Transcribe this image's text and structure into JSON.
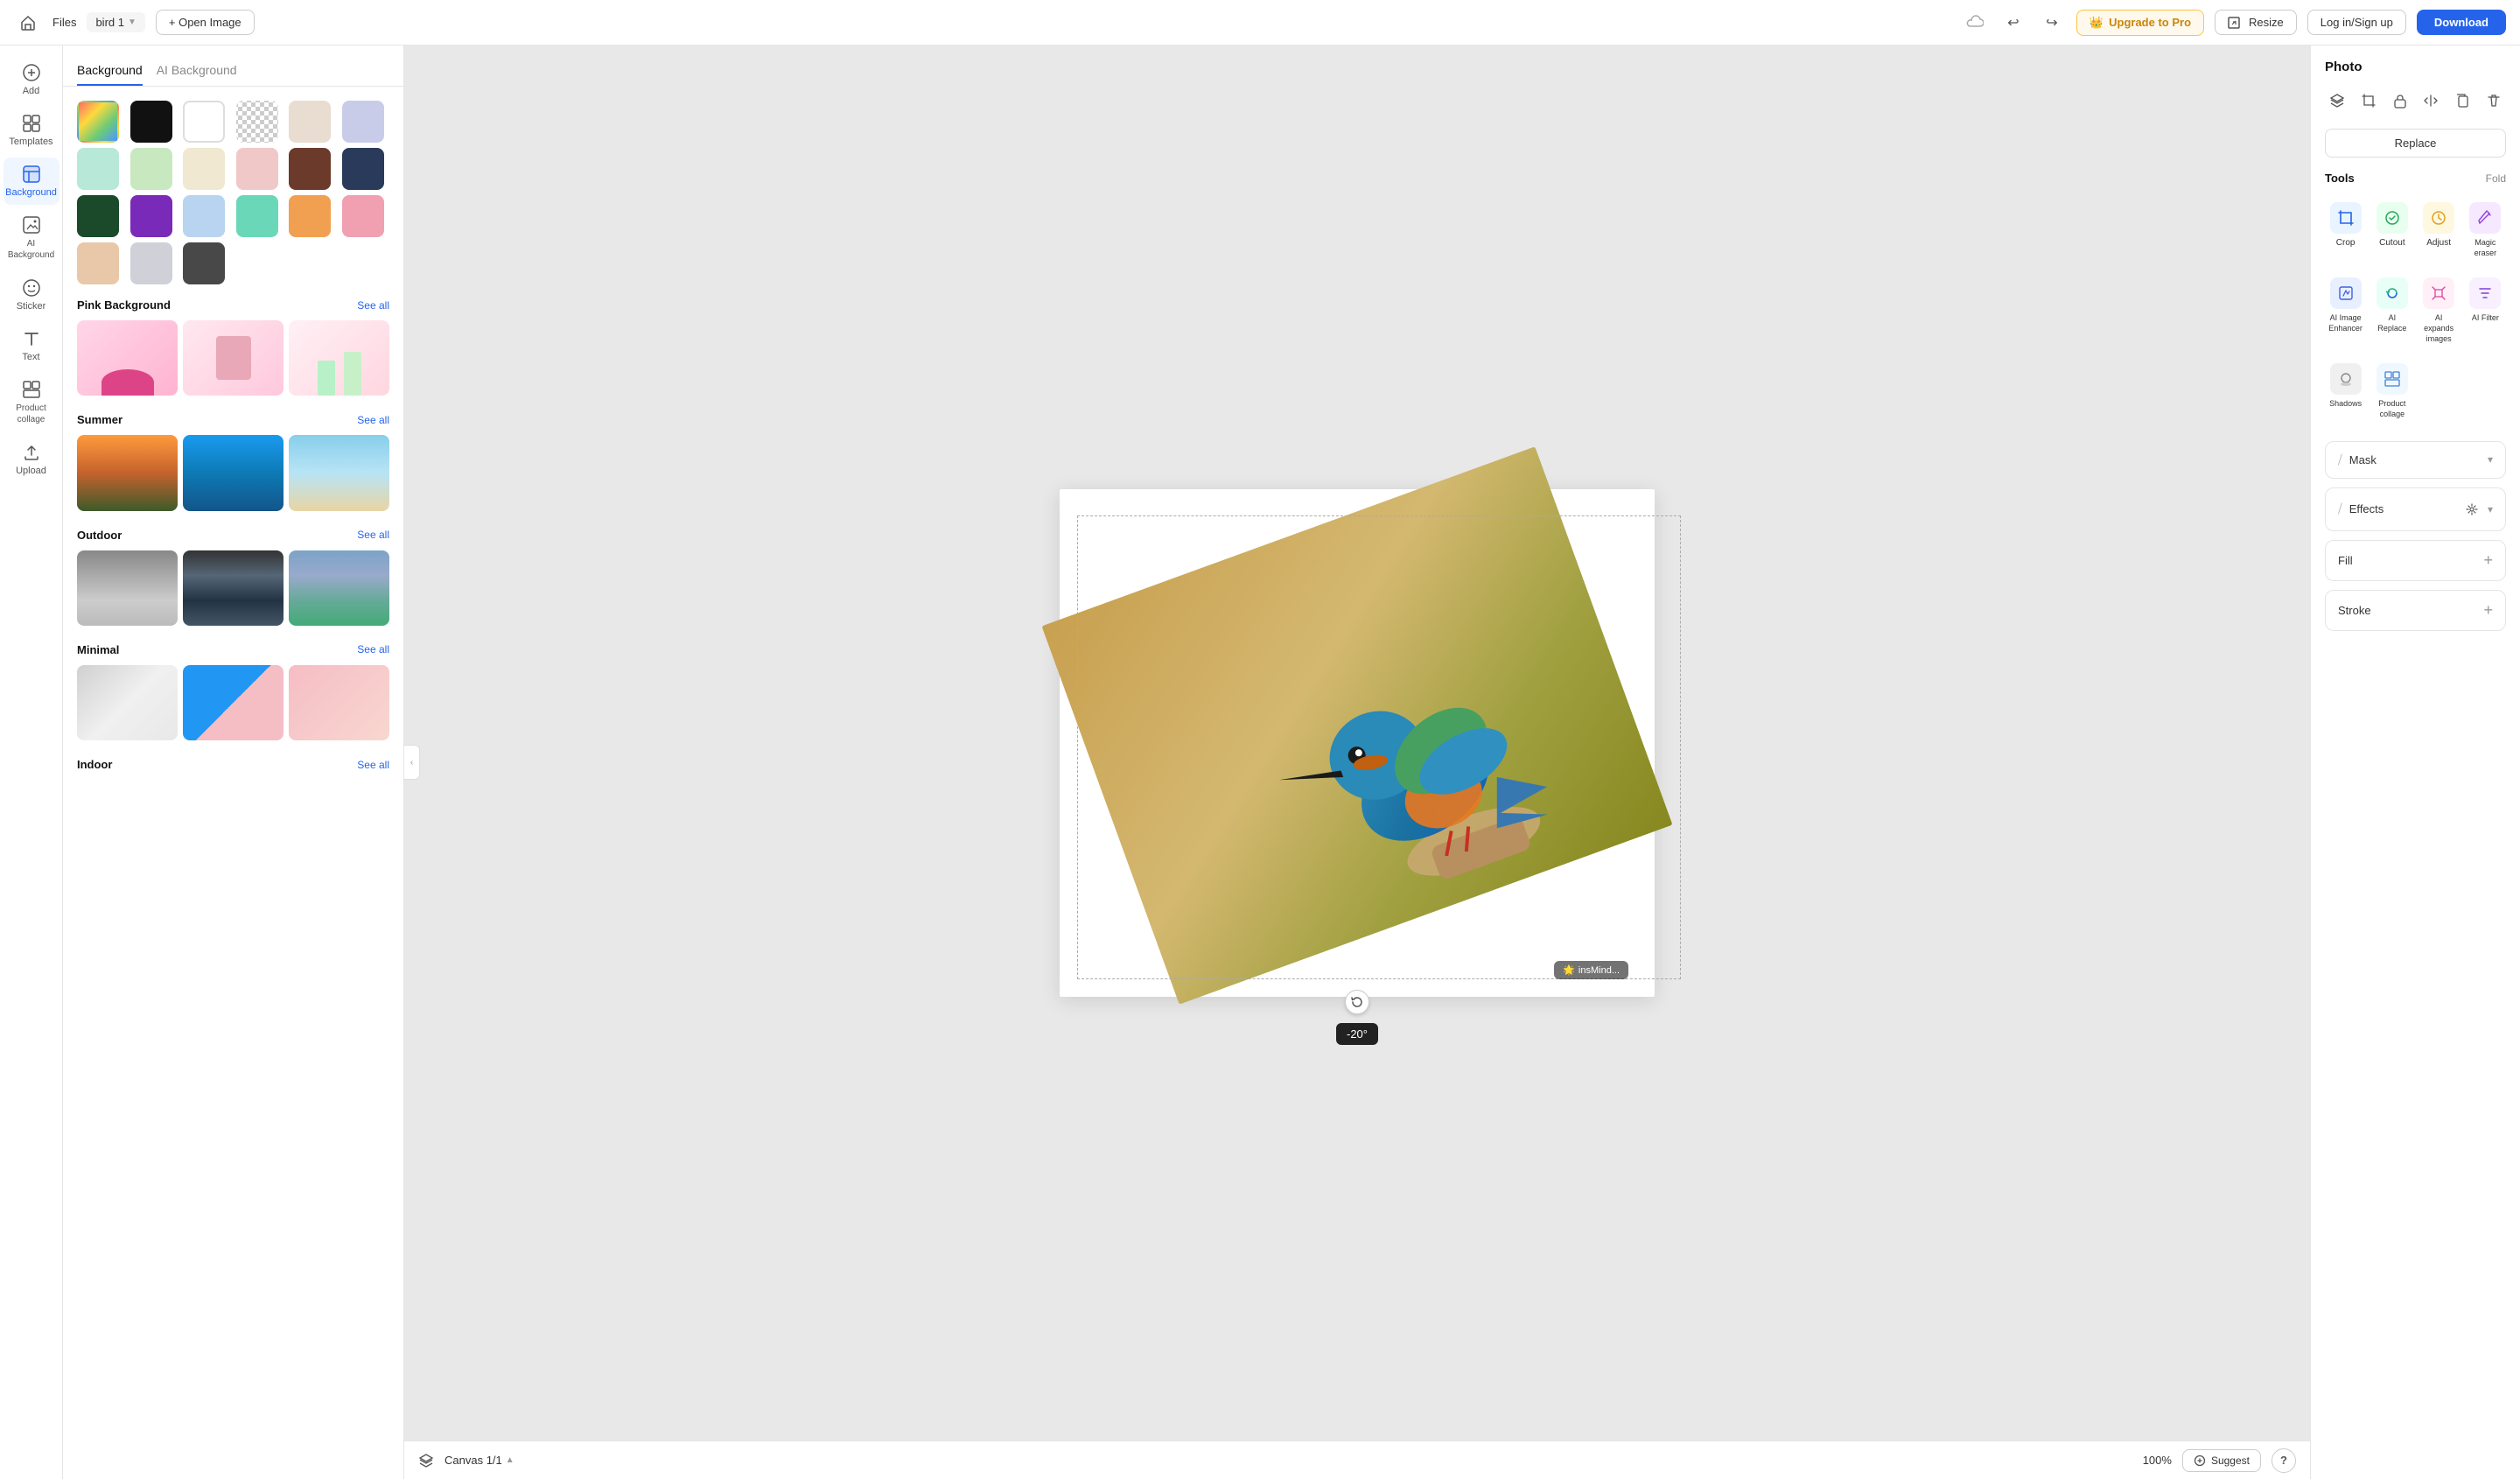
{
  "topbar": {
    "home_icon": "🏠",
    "files_label": "Files",
    "filename": "bird 1",
    "open_label": "+ Open Image",
    "cloud_icon": "☁",
    "undo_icon": "↩",
    "redo_icon": "↪",
    "upgrade_label": "Upgrade to Pro",
    "resize_label": "Resize",
    "login_label": "Log in/Sign up",
    "download_label": "Download"
  },
  "left_sidebar": {
    "items": [
      {
        "id": "add",
        "icon": "＋",
        "label": "Add"
      },
      {
        "id": "templates",
        "icon": "⊞",
        "label": "Templates"
      },
      {
        "id": "background",
        "icon": "▦",
        "label": "Background",
        "active": true
      },
      {
        "id": "ai-background",
        "icon": "🤖",
        "label": "AI Background"
      },
      {
        "id": "sticker",
        "icon": "😊",
        "label": "Sticker"
      },
      {
        "id": "text",
        "icon": "T",
        "label": "Text"
      },
      {
        "id": "product-collage",
        "icon": "⊟",
        "label": "Product collage"
      },
      {
        "id": "upload",
        "icon": "↑",
        "label": "Upload"
      }
    ]
  },
  "panel": {
    "tabs": [
      {
        "id": "background",
        "label": "Background",
        "active": true
      },
      {
        "id": "ai-background",
        "label": "AI Background"
      }
    ],
    "color_swatches": [
      {
        "id": "gradient",
        "type": "gradient",
        "selected": false
      },
      {
        "id": "black",
        "color": "#111111",
        "selected": false
      },
      {
        "id": "white",
        "color": "#ffffff",
        "selected": true,
        "type": "white"
      },
      {
        "id": "transparent",
        "color": "transparent",
        "type": "transparent"
      },
      {
        "id": "beige",
        "color": "#e8ddd0",
        "selected": false
      },
      {
        "id": "lavender",
        "color": "#c8cce8",
        "selected": false
      },
      {
        "id": "mint",
        "color": "#b8e8d8",
        "selected": false
      },
      {
        "id": "light-green",
        "color": "#c8e8c0",
        "selected": false
      },
      {
        "id": "cream",
        "color": "#f0e8d0",
        "selected": false
      },
      {
        "id": "light-pink",
        "color": "#f0c8c8",
        "selected": false
      },
      {
        "id": "brown",
        "color": "#6b3a2a",
        "selected": false
      },
      {
        "id": "navy",
        "color": "#2a3a5a",
        "selected": false
      },
      {
        "id": "dark-green",
        "color": "#1a4a2a",
        "selected": false
      },
      {
        "id": "purple",
        "color": "#7a2ab8",
        "selected": false
      },
      {
        "id": "light-blue",
        "color": "#b8d4f0",
        "selected": false
      },
      {
        "id": "teal",
        "color": "#6ad8b8",
        "selected": false
      },
      {
        "id": "orange",
        "color": "#f0a050",
        "selected": false
      },
      {
        "id": "pink",
        "color": "#f0a0b0",
        "selected": false
      },
      {
        "id": "peach",
        "color": "#e8c8a8",
        "selected": false
      },
      {
        "id": "light-gray",
        "color": "#d0d0d8",
        "selected": false
      },
      {
        "id": "dark-gray",
        "color": "#484848",
        "selected": false
      }
    ],
    "sections": [
      {
        "id": "pink",
        "title": "Pink Background",
        "see_all": "See all",
        "thumbs": [
          "pink-bg-1",
          "pink-bg-2",
          "pink-bg-3"
        ]
      },
      {
        "id": "summer",
        "title": "Summer",
        "see_all": "See all",
        "thumbs": [
          "summer-1",
          "summer-2",
          "summer-3"
        ]
      },
      {
        "id": "outdoor",
        "title": "Outdoor",
        "see_all": "See all",
        "thumbs": [
          "outdoor-1",
          "outdoor-2",
          "outdoor-3"
        ]
      },
      {
        "id": "minimal",
        "title": "Minimal",
        "see_all": "See all",
        "thumbs": [
          "minimal-1",
          "minimal-2",
          "minimal-3"
        ]
      },
      {
        "id": "indoor",
        "title": "Indoor",
        "see_all": "See all",
        "thumbs": []
      }
    ]
  },
  "canvas": {
    "rotation_label": "-20°",
    "watermark": "insMind...",
    "canvas_label": "Canvas 1/1",
    "zoom": "100%",
    "suggest_label": "Suggest",
    "help_label": "?"
  },
  "right_panel": {
    "title": "Photo",
    "replace_label": "Replace",
    "tools_section": {
      "title": "Tools",
      "fold_label": "Fold",
      "tools": [
        {
          "id": "crop",
          "label": "Crop",
          "icon": "crop"
        },
        {
          "id": "cutout",
          "label": "Cutout",
          "icon": "cutout"
        },
        {
          "id": "adjust",
          "label": "Adjust",
          "icon": "adjust"
        },
        {
          "id": "magic-eraser",
          "label": "Magic eraser",
          "icon": "eraser"
        },
        {
          "id": "ai-image-enhancer",
          "label": "AI Image Enhancer",
          "icon": "enhancer"
        },
        {
          "id": "ai-replace",
          "label": "AI Replace",
          "icon": "ai-replace"
        },
        {
          "id": "ai-expands",
          "label": "AI expands images",
          "icon": "ai-expand"
        },
        {
          "id": "ai-filter",
          "label": "AI Filter",
          "icon": "ai-filter"
        },
        {
          "id": "shadows",
          "label": "Shadows",
          "icon": "shadows"
        },
        {
          "id": "product-collage",
          "label": "Product collage",
          "icon": "collage"
        }
      ]
    },
    "mask_section": {
      "title": "Mask"
    },
    "effects_section": {
      "title": "Effects"
    },
    "fill_section": {
      "title": "Fill"
    },
    "stroke_section": {
      "title": "Stroke"
    }
  }
}
